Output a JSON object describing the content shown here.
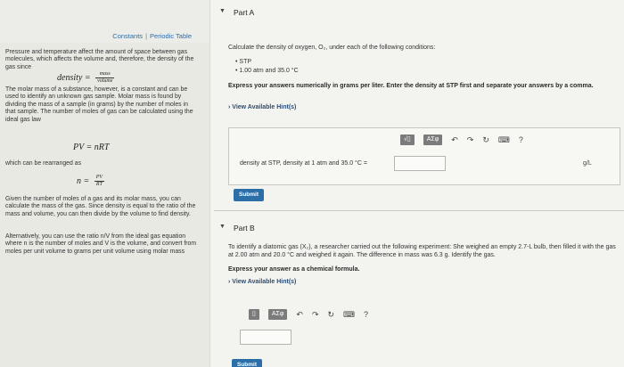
{
  "left_panel": {
    "links": {
      "constants": "Constants",
      "separator": "|",
      "periodic_table": "Periodic Table"
    },
    "intro": "Pressure and temperature affect the amount of space between gas molecules, which affects the volume and, therefore, the density of the gas since",
    "density_eq": {
      "lhs": "density =",
      "num": "mass",
      "den": "volume"
    },
    "molar_mass_text": "The molar mass of a substance, however, is a constant and can be used to identify an unknown gas sample. Molar mass is found by dividing the mass of a sample (in grams) by the number of moles in that sample. The number of moles of gas can be calculated using the ideal gas law",
    "ideal_gas_eq": "PV = nRT",
    "rearranged_text": "which can be rearranged as",
    "n_eq": {
      "lhs": "n =",
      "num": "PV",
      "den": "RT"
    },
    "given_text": "Given the number of moles of a gas and its molar mass, you can calculate the mass of the gas. Since density is equal to the ratio of the mass and volume, you can then divide by the volume to find density.",
    "alternative_text": "Alternatively, you can use the ratio n/V from the ideal gas equation where n is the number of moles and V is the volume, and convert from moles per unit volume to grams per unit volume using molar mass"
  },
  "part_a": {
    "title": "Part A",
    "question": "Calculate the density of oxygen, O₂, under each of the following conditions:",
    "bullets": [
      "STP",
      "1.00 atm and 35.0 °C"
    ],
    "instruction": "Express your answers numerically in grams per liter. Enter the density at STP first and separate your answers by a comma.",
    "hint_label": "View Available Hint(s)",
    "toolbar": {
      "template": "√▯",
      "symbols": "ΑΣφ",
      "help": "?"
    },
    "answer_label": "density at STP, density at 1 atm and 35.0 °C =",
    "unit": "g/L",
    "submit": "Submit"
  },
  "part_b": {
    "title": "Part B",
    "question": "To identify a diatomic gas (X₂), a researcher carried out the following experiment: She weighed an empty 2.7-L bulb, then filled it with the gas at 2.00 atm and 20.0 °C and weighed it again. The difference in mass was 6.3 g. Identify the gas.",
    "instruction": "Express your answer as a chemical formula.",
    "hint_label": "View Available Hint(s)",
    "toolbar": {
      "template": "▯",
      "symbols": "ΑΣφ",
      "help": "?"
    },
    "submit": "Submit"
  }
}
